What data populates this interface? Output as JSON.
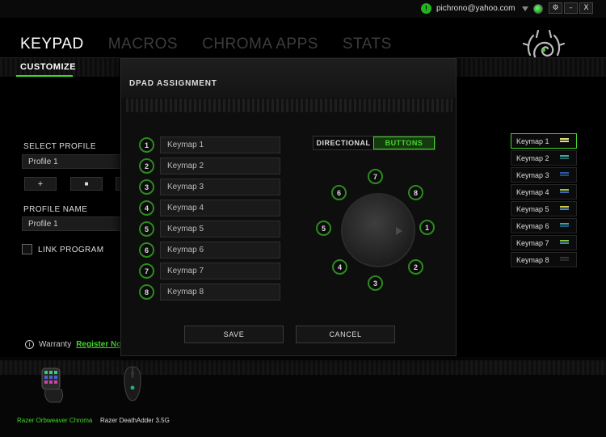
{
  "account": {
    "email": "pichrono@yahoo.com",
    "status_badge": "!"
  },
  "window_controls": {
    "settings": "⚙",
    "minimize": "–",
    "close": "X"
  },
  "main_tabs": [
    "KEYPAD",
    "MACROS",
    "CHROMA APPS",
    "STATS"
  ],
  "sub_tabs": [
    "CUSTOMIZE"
  ],
  "left_panel": {
    "select_profile_label": "SELECT PROFILE",
    "profile_value": "Profile 1",
    "add_label": "+",
    "delete_label": "■",
    "profile_name_label": "PROFILE NAME",
    "profile_name_value": "Profile 1",
    "link_program_label": "LINK PROGRAM",
    "warranty_label": "Warranty",
    "register_label": "Register No"
  },
  "keymaps": [
    {
      "label": "Keymap 1",
      "colors": [
        "#e5e07a",
        "#e5e07a"
      ]
    },
    {
      "label": "Keymap 2",
      "colors": [
        "#3aa8a0",
        "#2a6a64"
      ]
    },
    {
      "label": "Keymap 3",
      "colors": [
        "#2a5aa8",
        "#234a88"
      ]
    },
    {
      "label": "Keymap 4",
      "colors": [
        "#9ac24a",
        "#3a6ab8"
      ]
    },
    {
      "label": "Keymap 5",
      "colors": [
        "#d0cf40",
        "#3a8ac8"
      ]
    },
    {
      "label": "Keymap 6",
      "colors": [
        "#3aa8a0",
        "#1e5a8a"
      ]
    },
    {
      "label": "Keymap 7",
      "colors": [
        "#8ac03a",
        "#3a8ab0"
      ]
    },
    {
      "label": "Keymap 8",
      "colors": [
        "#333333",
        "#2a2a2a"
      ]
    }
  ],
  "devices": [
    {
      "name": "Razer Orbweaver Chroma",
      "active": true
    },
    {
      "name": "Razer DeathAdder 3.5G",
      "active": false
    }
  ],
  "modal": {
    "title": "DPAD ASSIGNMENT",
    "rows": [
      {
        "num": "1",
        "value": "Keymap 1"
      },
      {
        "num": "2",
        "value": "Keymap 2"
      },
      {
        "num": "3",
        "value": "Keymap 3"
      },
      {
        "num": "4",
        "value": "Keymap 4"
      },
      {
        "num": "5",
        "value": "Keymap 5"
      },
      {
        "num": "6",
        "value": "Keymap 6"
      },
      {
        "num": "7",
        "value": "Keymap 7"
      },
      {
        "num": "8",
        "value": "Keymap 8"
      }
    ],
    "mode_directional": "DIRECTIONAL",
    "mode_buttons": "BUTTONS",
    "active_mode": "BUTTONS",
    "directions": [
      "1",
      "2",
      "3",
      "4",
      "5",
      "6",
      "7",
      "8"
    ],
    "save_label": "SAVE",
    "cancel_label": "CANCEL"
  },
  "colors": {
    "accent": "#44d62c"
  }
}
